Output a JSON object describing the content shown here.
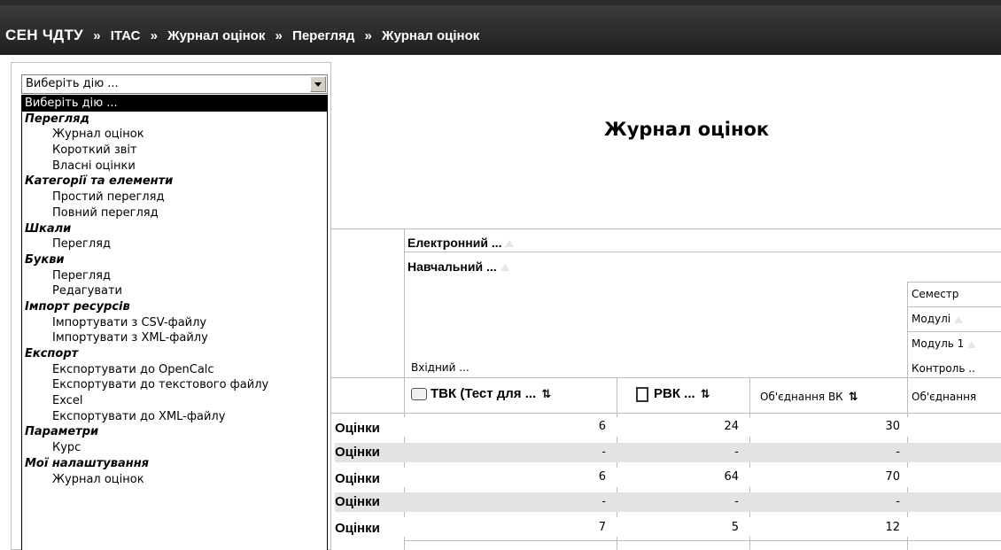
{
  "breadcrumb": {
    "home": "СЕН ЧДТУ",
    "separator": "»",
    "items": [
      "ІТАС",
      "Журнал оцінок",
      "Перегляд",
      "Журнал оцінок"
    ]
  },
  "action_select": {
    "value": "Виберіть дію ...",
    "options": [
      {
        "type": "opt",
        "label": "Виберіть дію ...",
        "selected": true
      },
      {
        "type": "group",
        "label": "Перегляд"
      },
      {
        "type": "sub",
        "label": "Журнал оцінок"
      },
      {
        "type": "sub",
        "label": "Короткий звіт"
      },
      {
        "type": "sub",
        "label": "Власні оцінки"
      },
      {
        "type": "group",
        "label": "Категорії та елементи"
      },
      {
        "type": "sub",
        "label": "Простий перегляд"
      },
      {
        "type": "sub",
        "label": "Повний перегляд"
      },
      {
        "type": "group",
        "label": "Шкали"
      },
      {
        "type": "sub",
        "label": "Перегляд"
      },
      {
        "type": "group",
        "label": "Букви"
      },
      {
        "type": "sub",
        "label": "Перегляд"
      },
      {
        "type": "sub",
        "label": "Редагувати"
      },
      {
        "type": "group",
        "label": "Імпорт ресурсів"
      },
      {
        "type": "sub",
        "label": "Імпортувати з CSV-файлу"
      },
      {
        "type": "sub",
        "label": "Імпортувати з XML-файлу"
      },
      {
        "type": "group",
        "label": "Експорт"
      },
      {
        "type": "sub",
        "label": "Експортувати до OpenCalc"
      },
      {
        "type": "sub",
        "label": "Експортувати до текстового файлу"
      },
      {
        "type": "sub",
        "label": "Excel"
      },
      {
        "type": "sub",
        "label": "Експортувати до XML-файлу"
      },
      {
        "type": "group",
        "label": "Параметри"
      },
      {
        "type": "sub",
        "label": "Курс"
      },
      {
        "type": "group",
        "label": "Мої налаштування"
      },
      {
        "type": "sub",
        "label": "Журнал оцінок"
      }
    ]
  },
  "page_title": "Журнал оцінок",
  "table": {
    "categories": {
      "electronic": "Електронний ...",
      "educational": "Навчальний ...",
      "semester": "Семестр",
      "modules": "Модулі",
      "module1": "Модуль 1",
      "control": "Контроль ..",
      "incoming": "Вхідний ..."
    },
    "columns": [
      {
        "label": "ТВК (Тест для ...",
        "icon": "quiz-icon"
      },
      {
        "label": "РВК ...",
        "icon": "assignment-icon"
      },
      {
        "label": "Об'єднання ВК",
        "icon": ""
      },
      {
        "label": "Об'єднання",
        "icon": ""
      }
    ],
    "sort_glyph": "⇅",
    "row_label": "Оцінки",
    "rows": [
      {
        "label": "Оцінки",
        "values": [
          "6",
          "24",
          "30"
        ]
      },
      {
        "label": "Оцінки",
        "values": [
          "-",
          "-",
          "-"
        ]
      },
      {
        "label": "Оцінки",
        "values": [
          "6",
          "64",
          "70"
        ]
      },
      {
        "label": "Оцінки",
        "values": [
          "-",
          "-",
          "-"
        ]
      },
      {
        "label": "Оцінки",
        "values": [
          "7",
          "5",
          "12"
        ]
      }
    ]
  },
  "colors": {
    "navbar_bg": "#2b2b2b",
    "row_grey": "#e3e3e3",
    "selected_option_bg": "#000000"
  }
}
